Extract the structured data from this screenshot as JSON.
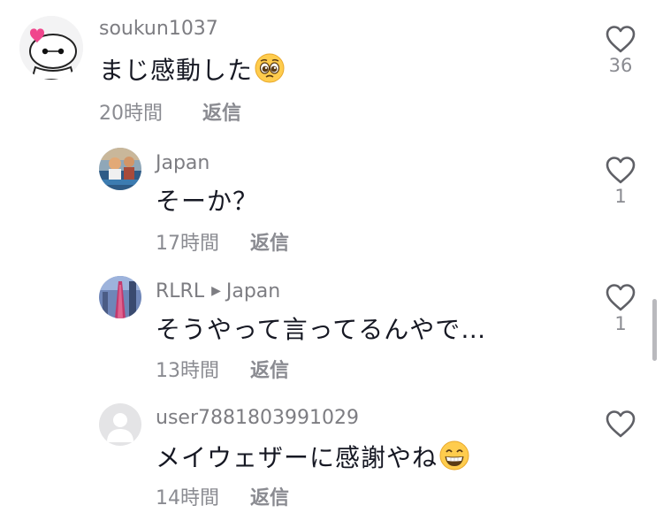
{
  "comments": [
    {
      "username": "soukun1037",
      "text": "まじ感動した",
      "emoji": "pleading-face",
      "time": "20時間",
      "reply_label": "返信",
      "likes": "36",
      "avatar": "baymax-avatar"
    },
    {
      "username": "Japan",
      "text": "そーか？",
      "time": "17時間",
      "reply_label": "返信",
      "likes": "1",
      "avatar": "photo-avatar"
    },
    {
      "username": "RLRL",
      "reply_to": "Japan",
      "text": "そうやって言ってるんやで…",
      "time": "13時間",
      "reply_label": "返信",
      "likes": "1",
      "avatar": "tower-avatar"
    },
    {
      "username": "user7881803991029",
      "text": "メイウェザーに感謝やね",
      "emoji": "grinning-face",
      "time": "14時間",
      "reply_label": "返信",
      "likes": "",
      "avatar": "default-avatar"
    }
  ],
  "colors": {
    "text": "#161823",
    "muted": "#8a8b91",
    "icon": "#5f6066"
  }
}
